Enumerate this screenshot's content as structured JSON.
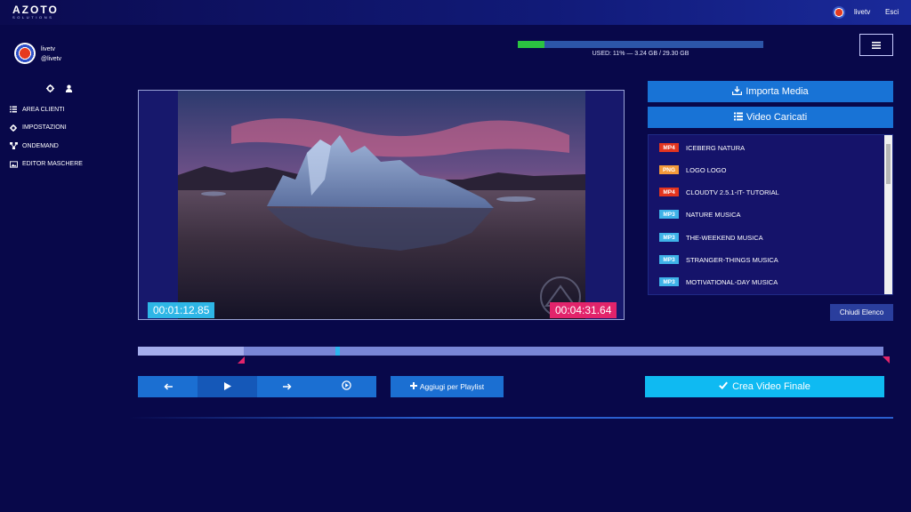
{
  "header": {
    "logo_text": "AZOTO",
    "logo_sub": "SOLUTIONS",
    "username": "livetv",
    "logout": "Esci"
  },
  "sidebar": {
    "name": "livetv",
    "handle": "@livetv",
    "tools": [
      "gear-icon",
      "user-icon"
    ],
    "menu": [
      {
        "label": "AREA CLIENTI",
        "icon": "list-icon"
      },
      {
        "label": "IMPOSTAZIONI",
        "icon": "gear-icon"
      },
      {
        "label": "ONDEMAND",
        "icon": "network-icon"
      },
      {
        "label": "EDITOR MASCHERE",
        "icon": "image-icon"
      }
    ]
  },
  "storage": {
    "text": "USED: 11% — 3.24 GB / 29.30 GB",
    "percent": 11,
    "fill_color": "#2bc341"
  },
  "player": {
    "current_time": "00:01:12.85",
    "total_time": "00:04:31.64",
    "timeline_played_fraction": 0.142,
    "playhead_fraction": 0.265
  },
  "actions": {
    "import_media": "Importa Media",
    "uploaded_videos": "Video Caricati",
    "close_list": "Chiudi Elenco",
    "add_playlist": "Aggiugi per Playlist",
    "create_final": "Crea Video Finale"
  },
  "media": [
    {
      "type": "MP4",
      "name": "ICEBERG NATURA",
      "color": "#e3351f"
    },
    {
      "type": "PNG",
      "name": "LOGO LOGO",
      "color": "#f39a3a"
    },
    {
      "type": "MP4",
      "name": "CLOUDTV 2.5.1-IT- TUTORIAL",
      "color": "#e3351f"
    },
    {
      "type": "MP3",
      "name": "NATURE MUSICA",
      "color": "#3fb3e8"
    },
    {
      "type": "MP3",
      "name": "THE-WEEKEND MUSICA",
      "color": "#3fb3e8"
    },
    {
      "type": "MP3",
      "name": "STRANGER-THINGS MUSICA",
      "color": "#3fb3e8"
    },
    {
      "type": "MP3",
      "name": "MOTIVATIONAL-DAY MUSICA",
      "color": "#3fb3e8"
    }
  ],
  "controls": [
    "arrow-left-icon",
    "play-icon",
    "arrow-right-icon",
    "play-circle-icon"
  ]
}
